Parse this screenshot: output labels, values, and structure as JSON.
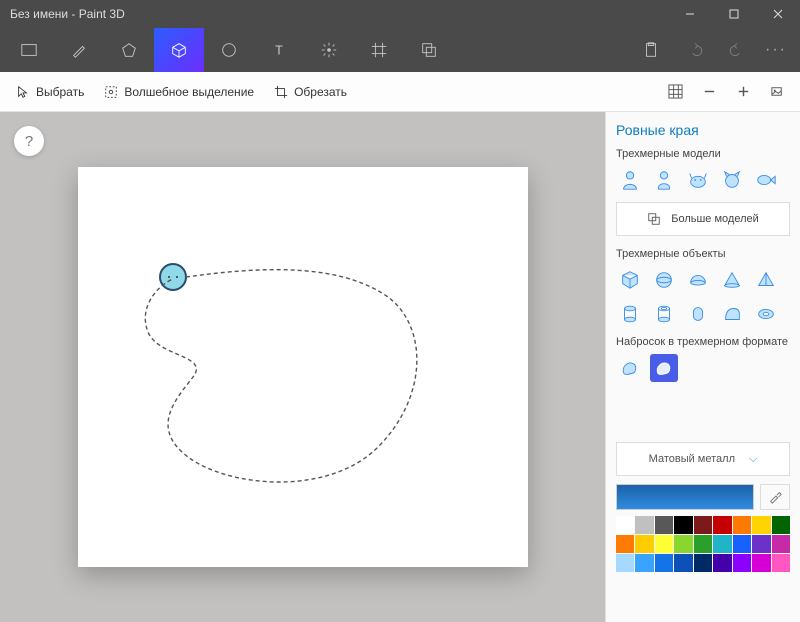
{
  "titlebar": {
    "title": "Без имени - Paint 3D"
  },
  "cmdbar": {
    "select": "Выбрать",
    "magic": "Волшебное выделение",
    "crop": "Обрезать"
  },
  "panel": {
    "heading": "Ровные края",
    "models_title": "Трехмерные модели",
    "more_models": "Больше моделей",
    "objects_title": "Трехмерные объекты",
    "sketch_title": "Набросок в трехмерном формате",
    "material": "Матовый металл"
  },
  "help": "?",
  "palette": [
    "#ffffff",
    "#c0c0c0",
    "#585858",
    "#000000",
    "#7c1a1a",
    "#c40000",
    "#ff7a00",
    "#ffd400",
    "#006400",
    "#ff7a00",
    "#ffcc00",
    "#ffff33",
    "#89d62f",
    "#2aa02a",
    "#1fb4c8",
    "#1961ff",
    "#6a32c9",
    "#c72aa6",
    "#a6d9ff",
    "#3aa3ff",
    "#1473e6",
    "#0d51b8",
    "#002a66",
    "#4400aa",
    "#8b00ff",
    "#d400d4",
    "#ff57c1"
  ]
}
